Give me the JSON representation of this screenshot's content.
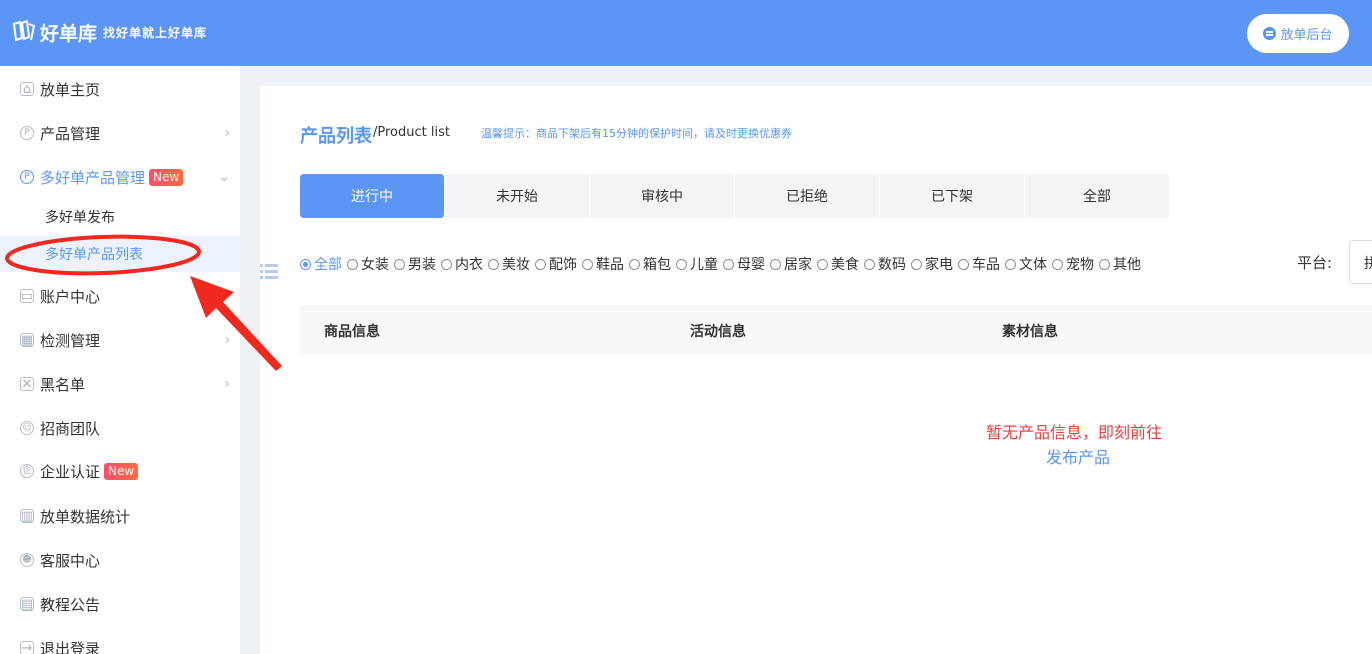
{
  "header": {
    "logo_name": "好单库",
    "slogan": "找好单就上好单库",
    "admin_button": "放单后台",
    "brand_color": "#5b96f5"
  },
  "sidebar": {
    "items": [
      {
        "label": "放单主页",
        "icon": "home-icon"
      },
      {
        "label": "产品管理",
        "icon": "p-circle-icon"
      },
      {
        "label": "多好单产品管理",
        "icon": "p-circle-icon",
        "badge": "New"
      },
      {
        "label": "账户中心",
        "icon": "card-icon"
      },
      {
        "label": "检测管理",
        "icon": "calendar-icon"
      },
      {
        "label": "黑名单",
        "icon": "shield-icon"
      },
      {
        "label": "招商团队",
        "icon": "users-icon"
      },
      {
        "label": "企业认证",
        "icon": "company-icon",
        "badge": "New"
      },
      {
        "label": "放单数据统计",
        "icon": "bar-chart-icon"
      },
      {
        "label": "客服中心",
        "icon": "support-icon"
      },
      {
        "label": "教程公告",
        "icon": "building-icon"
      },
      {
        "label": "退出登录",
        "icon": "logout-icon"
      }
    ],
    "subitems": [
      {
        "label": "多好单发布"
      },
      {
        "label": "多好单产品列表"
      }
    ]
  },
  "main": {
    "title": "产品列表",
    "subtitle": "/Product list",
    "tip": "温馨提示：商品下架后有15分钟的保护时间，请及时更换优惠券",
    "tabs": [
      "进行中",
      "未开始",
      "审核中",
      "已拒绝",
      "已下架",
      "全部"
    ],
    "categories": [
      "全部",
      "女装",
      "男装",
      "内衣",
      "美妆",
      "配饰",
      "鞋品",
      "箱包",
      "儿童",
      "母婴",
      "居家",
      "美食",
      "数码",
      "家电",
      "车品",
      "文体",
      "宠物",
      "其他"
    ],
    "platform_label": "平台:",
    "platform_value": "拼",
    "columns": [
      "商品信息",
      "活动信息",
      "素材信息"
    ],
    "empty_text": "暂无产品信息，即刻前往",
    "empty_link": "发布产品"
  }
}
